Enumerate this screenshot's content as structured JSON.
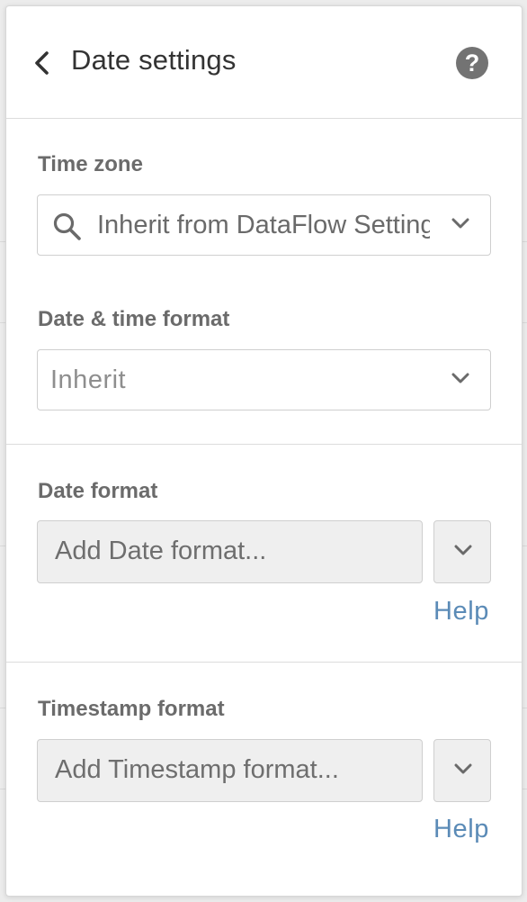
{
  "header": {
    "title": "Date settings",
    "help_glyph": "?"
  },
  "time_zone": {
    "label": "Time zone",
    "value": "Inherit from DataFlow Settings"
  },
  "datetime_format": {
    "label": "Date & time format",
    "value": "Inherit"
  },
  "date_format": {
    "label": "Date format",
    "placeholder": "Add Date format...",
    "help_label": "Help"
  },
  "timestamp_format": {
    "label": "Timestamp format",
    "placeholder": "Add Timestamp format...",
    "help_label": "Help"
  },
  "icons": {
    "back": "chevron-left-icon",
    "help": "question-circle-icon",
    "search": "search-icon",
    "dropdown": "chevron-down-icon"
  },
  "colors": {
    "link": "#5b8bb7",
    "help_circle": "#737373",
    "label": "#6b6b6b",
    "input_bg": "#efefef"
  }
}
